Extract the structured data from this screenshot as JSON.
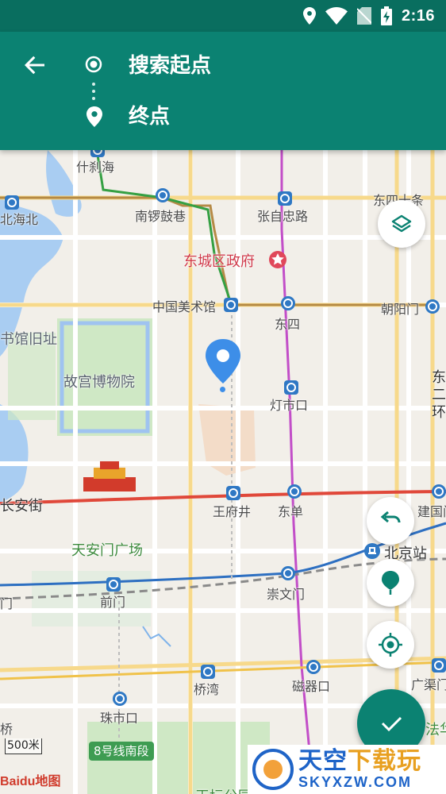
{
  "status_bar": {
    "time": "2:16",
    "icons": [
      "location-icon",
      "wifi-icon",
      "no-sim-icon",
      "battery-charging-icon"
    ]
  },
  "header": {
    "start_placeholder": "搜索起点",
    "end_placeholder": "终点",
    "accent": "#0b8272"
  },
  "map": {
    "labels": {
      "shichahai": "什刹海",
      "nanluoguxiang": "南锣鼓巷",
      "zhangzizhonglu": "张自忠路",
      "dongsishitiao": "东四十条",
      "beihaibei": "北海北",
      "dongcheng_gov": "东城区政府",
      "meishuguan": "中国美术馆",
      "dongsi": "东四",
      "chaoyangmen": "朝阳门",
      "library": "书馆旧址",
      "palace_museum": "故宫博物院",
      "dengshikou": "灯市口",
      "dong_huan": "东二环",
      "changanjie": "长安街",
      "wangfujing": "王府井",
      "dongdan": "东单",
      "jianguomen": "建国门",
      "tiananmen_square": "天安门广场",
      "beijing_station": "北京站",
      "qianmen": "前门",
      "chongwenmen": "崇文门",
      "qiaowan": "桥湾",
      "ciqikou": "磁器口",
      "guangqumen": "广渠门",
      "zhushikou": "珠市口",
      "tiantan": "天坛公园",
      "fafa": "法华寺",
      "road_8": "8号线南段",
      "men_left": "门",
      "qiao_left": "桥"
    },
    "scale": "500米",
    "logo": "Baidu地图"
  },
  "watermark": {
    "title_main": "天空",
    "title_accent": "下载玩",
    "url": "SKYXZW.COM"
  }
}
